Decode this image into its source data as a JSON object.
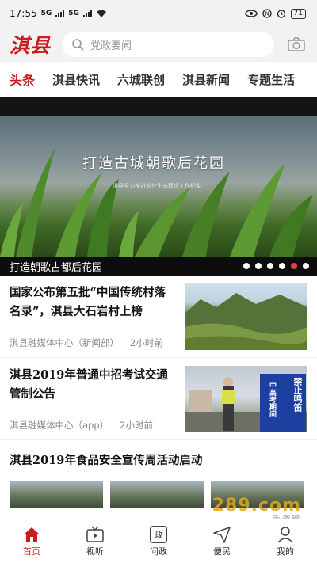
{
  "status_bar": {
    "time": "17:55",
    "network_1": "5G",
    "network_2": "5G",
    "battery": "71"
  },
  "header": {
    "logo": "淇县",
    "search_placeholder": "党政要闻"
  },
  "tabs": [
    {
      "label": "头条",
      "active": true
    },
    {
      "label": "淇县快讯",
      "active": false
    },
    {
      "label": "六城联创",
      "active": false
    },
    {
      "label": "淇县新闻",
      "active": false
    },
    {
      "label": "专题生活",
      "active": false
    }
  ],
  "banner": {
    "title": "打造古城朝歌后花园",
    "subtitle": "淇县全力推进农业生态建设工作纪实",
    "caption": "打造朝歌古都后花园",
    "slide_count": 6,
    "active_slide": 5
  },
  "news": [
    {
      "title": "国家公布第五批“中国传统村落名录”，淇县大石岩村上榜",
      "source": "淇县融媒体中心（新闻部）",
      "time": "2小时前",
      "thumb": "mountain-village"
    },
    {
      "title": "淇县2019年普通中招考试交通管制公告",
      "source": "淇县融媒体中心（app）",
      "time": "2小时前",
      "thumb": "traffic-control",
      "sign_text": "禁止鸣笛",
      "sign_side_text": "中高考期间"
    },
    {
      "title": "淇县2019年食品安全宣传周活动启动"
    }
  ],
  "watermark": {
    "main": "289.com",
    "sub": "手游网"
  },
  "bottom_nav": [
    {
      "label": "首页",
      "icon": "home-icon",
      "active": true
    },
    {
      "label": "视听",
      "icon": "tv-icon",
      "active": false
    },
    {
      "label": "问政",
      "icon": "zheng-box-icon",
      "glyph": "政",
      "active": false
    },
    {
      "label": "便民",
      "icon": "send-icon",
      "active": false
    },
    {
      "label": "我的",
      "icon": "user-icon",
      "active": false
    }
  ],
  "colors": {
    "brand_red": "#c81e1e",
    "active_dot": "#e04040"
  }
}
